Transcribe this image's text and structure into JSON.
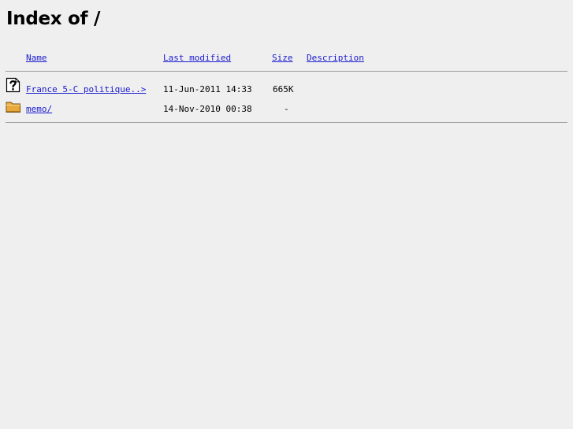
{
  "page": {
    "title": "Index of /"
  },
  "columns": {
    "name": "Name",
    "last_modified": "Last modified",
    "size": "Size",
    "description": "Description"
  },
  "entries": [
    {
      "icon": "unknown-file-icon",
      "name": "France 5-C politique..>",
      "last_modified": "11-Jun-2011 14:33",
      "size": "665K",
      "description": ""
    },
    {
      "icon": "folder-icon",
      "name": "memo/",
      "last_modified": "14-Nov-2010 00:38",
      "size": "-",
      "description": ""
    }
  ],
  "colors": {
    "background": "#efefef",
    "link": "#1a1ad0",
    "rule": "#9a9a9a",
    "folder": "#e8a93a"
  }
}
